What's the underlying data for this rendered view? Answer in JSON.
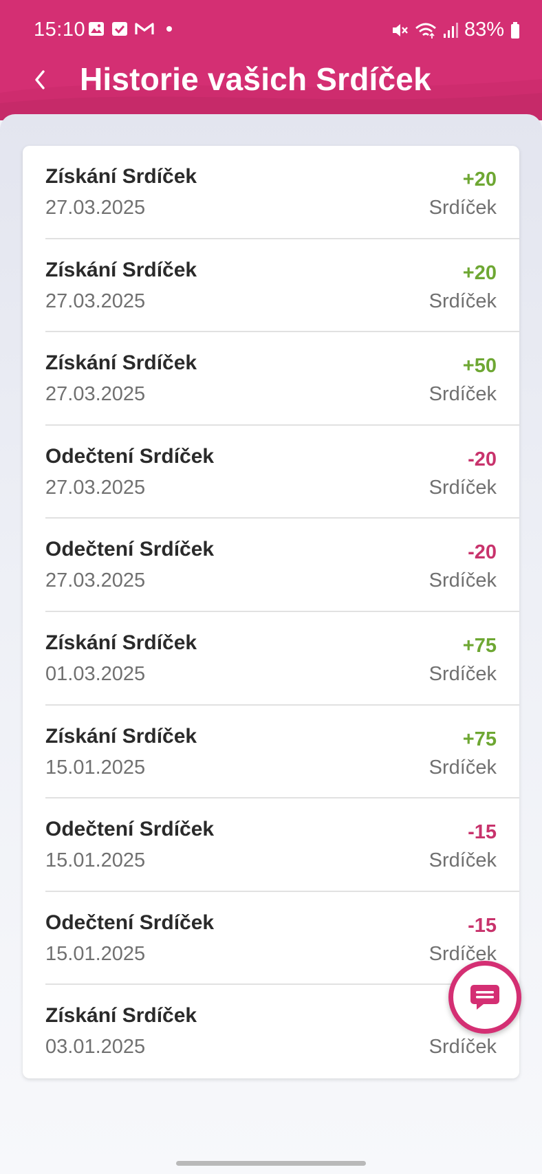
{
  "status_bar": {
    "time": "15:10",
    "battery": "83%",
    "left_icons": [
      "image-icon",
      "check-box-icon",
      "gmail-icon",
      "dot-icon"
    ],
    "right_icons": [
      "mute-icon",
      "wifi-icon",
      "signal-icon",
      "battery-icon"
    ]
  },
  "header": {
    "title": "Historie vašich Srdíček",
    "accent_color": "#d42f73"
  },
  "colors": {
    "positive": "#6ea733",
    "negative": "#c8336c"
  },
  "history": [
    {
      "title": "Získání Srdíček",
      "date": "27.03.2025",
      "amount": "+20",
      "unit": "Srdíček"
    },
    {
      "title": "Získání Srdíček",
      "date": "27.03.2025",
      "amount": "+20",
      "unit": "Srdíček"
    },
    {
      "title": "Získání Srdíček",
      "date": "27.03.2025",
      "amount": "+50",
      "unit": "Srdíček"
    },
    {
      "title": "Odečtení Srdíček",
      "date": "27.03.2025",
      "amount": "-20",
      "unit": "Srdíček"
    },
    {
      "title": "Odečtení Srdíček",
      "date": "27.03.2025",
      "amount": "-20",
      "unit": "Srdíček"
    },
    {
      "title": "Získání Srdíček",
      "date": "01.03.2025",
      "amount": "+75",
      "unit": "Srdíček"
    },
    {
      "title": "Získání Srdíček",
      "date": "15.01.2025",
      "amount": "+75",
      "unit": "Srdíček"
    },
    {
      "title": "Odečtení Srdíček",
      "date": "15.01.2025",
      "amount": "-15",
      "unit": "Srdíček"
    },
    {
      "title": "Odečtení Srdíček",
      "date": "15.01.2025",
      "amount": "-15",
      "unit": "Srdíček"
    },
    {
      "title": "Získání Srdíček",
      "date": "03.01.2025",
      "amount": "",
      "unit": "Srdíček"
    }
  ],
  "fab": {
    "icon": "chat-icon"
  }
}
